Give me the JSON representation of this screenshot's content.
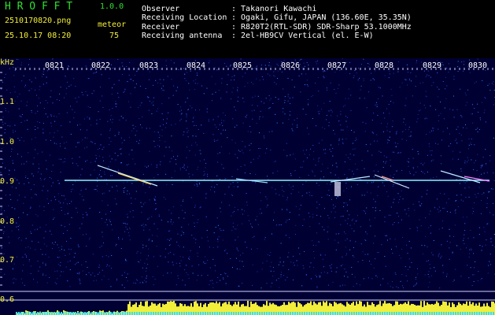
{
  "header": {
    "brand": "H R O F F T",
    "version": "1.0.0",
    "filename": "2510170820.png",
    "mode_label": "meteor",
    "timestamp": "25.10.17 08:20",
    "count": "75",
    "fields": [
      {
        "label": "Observer",
        "value": ": Takanori Kawachi"
      },
      {
        "label": "Receiving Location",
        "value": ": Ogaki, Gifu, JAPAN (136.60E, 35.35N)"
      },
      {
        "label": "Receiver",
        "value": ": R820T2(RTL-SDR) SDR-Sharp 53.1000MHz"
      },
      {
        "label": "Receiving antenna",
        "value": ": 2el-HB9CV Vertical (el. E-W)"
      }
    ]
  },
  "spectrogram": {
    "unit_label": "kHz",
    "time_labels": [
      "0821",
      "0822",
      "0823",
      "0824",
      "0825",
      "0826",
      "0827",
      "0828",
      "0829",
      "0830"
    ],
    "freq_labels": [
      "1.1",
      "1.0",
      "0.9",
      "0.8",
      "0.7",
      "0.6"
    ],
    "colors": {
      "text_yellow": "#f2ee3a",
      "text_green": "#2fe12f",
      "signal_line": "#8ff0ff",
      "background": "#000033"
    }
  }
}
